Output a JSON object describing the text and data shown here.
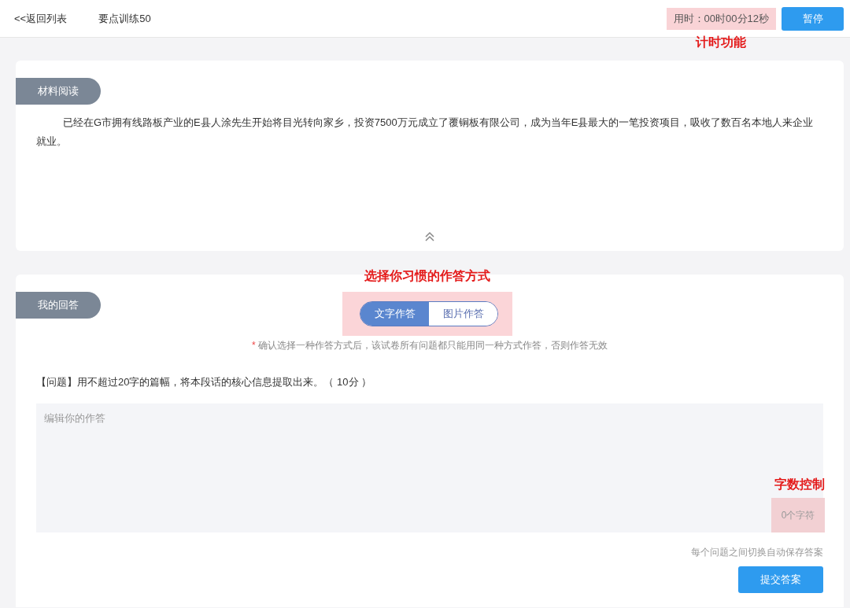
{
  "header": {
    "back_link": "<<返回列表",
    "title": "要点训练50",
    "timer": "用时：00时00分12秒",
    "timer_annotation": "计时功能",
    "pause_button": "暂停"
  },
  "material": {
    "label": "材料阅读",
    "text": "已经在G市拥有线路板产业的E县人涂先生开始将目光转向家乡，投资7500万元成立了覆铜板有限公司，成为当年E县最大的一笔投资项目，吸收了数百名本地人来企业就业。"
  },
  "answer": {
    "label": "我的回答",
    "modes_annotation": "选择你习惯的作答方式",
    "modes": [
      {
        "label": "文字作答",
        "selected": true
      },
      {
        "label": "图片作答",
        "selected": false
      }
    ],
    "note_mark": "*",
    "note": "确认选择一种作答方式后，该试卷所有问题都只能用同一种方式作答，否则作答无效",
    "question": "【问题】用不超过20字的篇幅，将本段话的核心信息提取出来。（ 10分 ）",
    "editor": {
      "placeholder": "编辑你的作答",
      "counter": "0个字符",
      "counter_annotation": "字数控制"
    },
    "autosave_note": "每个问题之间切换自动保存答案",
    "submit_button": "提交答案"
  }
}
